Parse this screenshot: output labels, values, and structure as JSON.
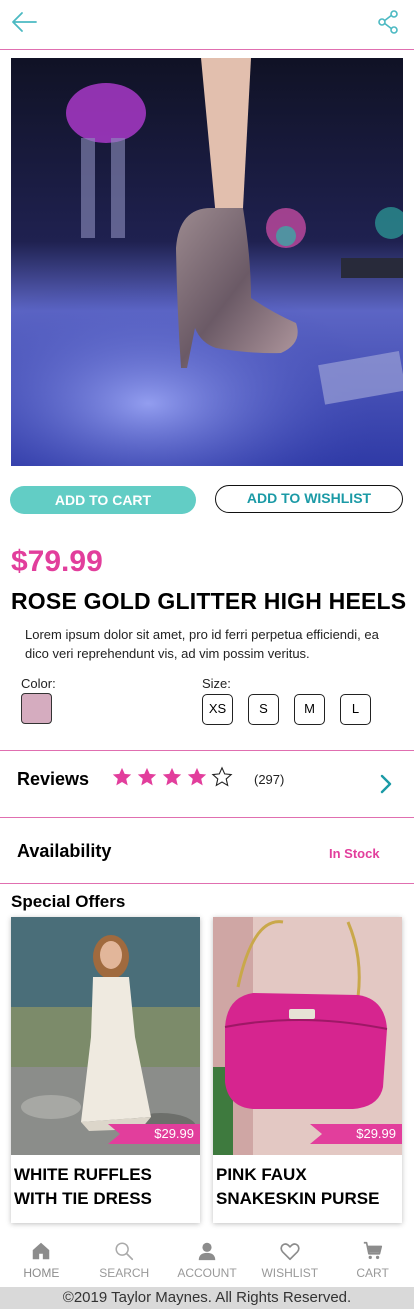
{
  "header": {
    "back_icon": "back-arrow-icon",
    "share_icon": "share-icon"
  },
  "product": {
    "image_alt": "Glitter high heel on stage",
    "add_to_cart": "ADD TO CART",
    "add_to_wishlist": "ADD TO WISHLIST",
    "price": "$79.99",
    "title": "ROSE GOLD GLITTER HIGH HEELS",
    "description": "Lorem ipsum dolor sit amet, pro id ferri perpetua efficiendi, ea dico veri reprehendunt vis, ad vim possim veritus.",
    "color_label": "Color:",
    "color_value": "#d5acbf",
    "size_label": "Size:",
    "sizes": [
      "XS",
      "S",
      "M",
      "L"
    ]
  },
  "reviews": {
    "label": "Reviews",
    "rating": 4,
    "max_rating": 5,
    "count": "(297)"
  },
  "availability": {
    "label": "Availability",
    "status": "In Stock"
  },
  "offers": {
    "heading": "Special Offers",
    "items": [
      {
        "price": "$29.99",
        "name_line1": "WHITE RUFFLES",
        "name_line2": "WITH TIE DRESS"
      },
      {
        "price": "$29.99",
        "name_line1": "PINK FAUX",
        "name_line2": "SNAKESKIN PURSE"
      }
    ]
  },
  "nav": {
    "items": [
      {
        "label": "HOME",
        "icon": "home-icon"
      },
      {
        "label": "SEARCH",
        "icon": "search-icon"
      },
      {
        "label": "ACCOUNT",
        "icon": "account-icon"
      },
      {
        "label": "WISHLIST",
        "icon": "heart-icon"
      },
      {
        "label": "CART",
        "icon": "cart-icon"
      }
    ]
  },
  "footer": {
    "copyright": "©2019 Taylor Maynes. All Rights Reserved."
  },
  "colors": {
    "accent_pink": "#e23e9c",
    "accent_teal": "#62cdc5",
    "divider": "#e06fb0"
  }
}
